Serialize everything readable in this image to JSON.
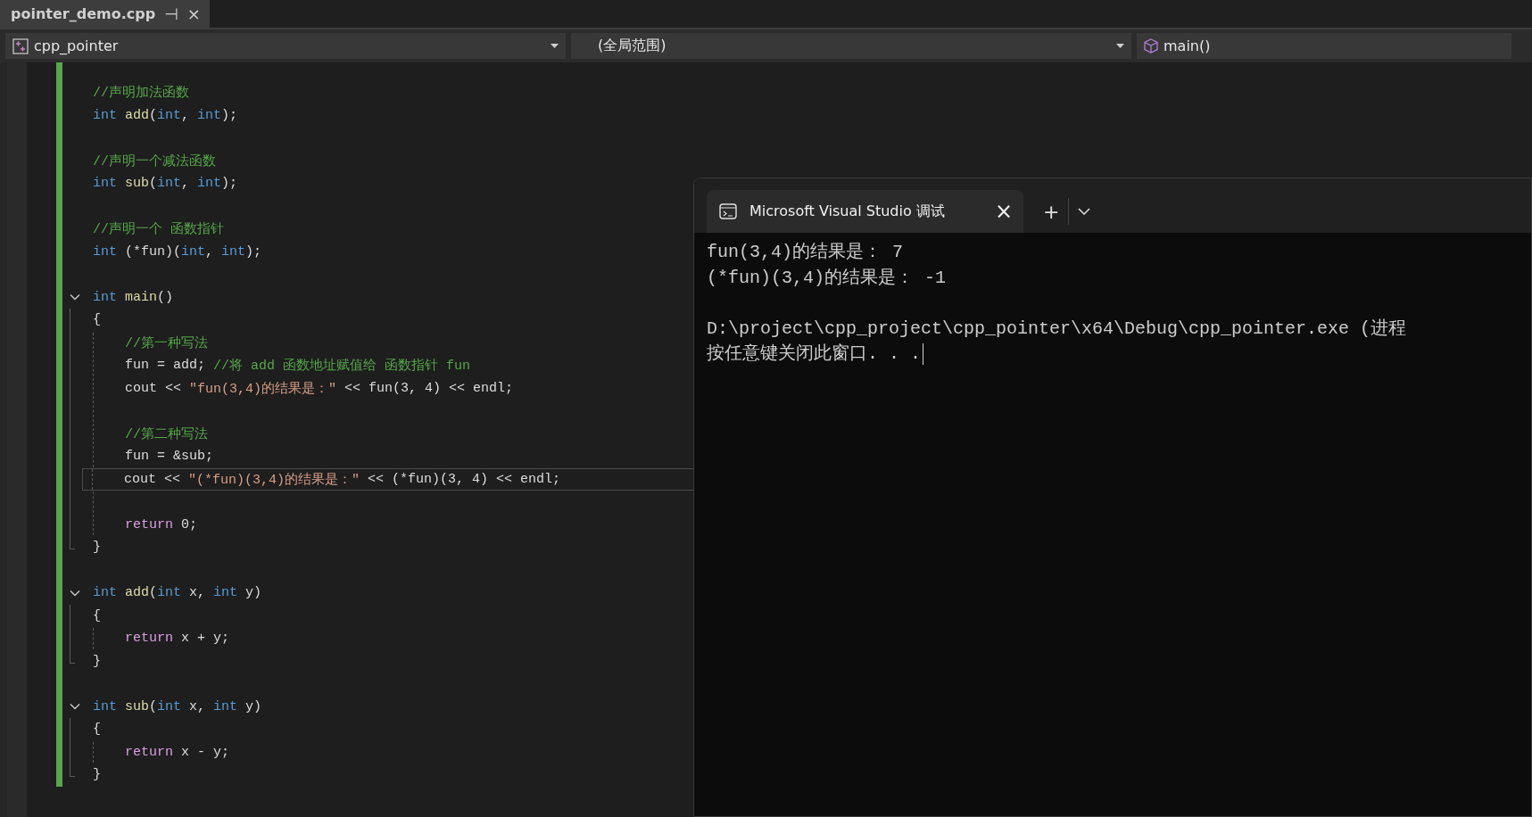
{
  "document_tab": {
    "title": "pointer_demo.cpp",
    "pin": "⊣",
    "close": "×",
    "selected": true
  },
  "navigation_bar": {
    "project": "cpp_pointer",
    "scope": "(全局范围)",
    "member": "main()"
  },
  "editor": {
    "modified": true,
    "lines": [
      {
        "kind": "plain",
        "tokens": [
          {
            "text": "//声明加法函数",
            "kind": "comment"
          }
        ]
      },
      {
        "kind": "plain",
        "tokens": [
          {
            "text": "int",
            "kind": "keyword"
          },
          {
            "text": " add",
            "kind": "function"
          },
          {
            "text": "(",
            "kind": "plain"
          },
          {
            "text": "int",
            "kind": "keyword"
          },
          {
            "text": ", ",
            "kind": "plain"
          },
          {
            "text": "int",
            "kind": "keyword"
          },
          {
            "text": ");",
            "kind": "plain"
          }
        ]
      },
      {
        "kind": "plain"
      },
      {
        "kind": "plain",
        "tokens": [
          {
            "text": "//声明一个减法函数",
            "kind": "comment"
          }
        ]
      },
      {
        "kind": "plain",
        "tokens": [
          {
            "text": "int",
            "kind": "keyword"
          },
          {
            "text": " sub",
            "kind": "function"
          },
          {
            "text": "(",
            "kind": "plain"
          },
          {
            "text": "int",
            "kind": "keyword"
          },
          {
            "text": ", ",
            "kind": "plain"
          },
          {
            "text": "int",
            "kind": "keyword"
          },
          {
            "text": ");",
            "kind": "plain"
          }
        ]
      },
      {
        "kind": "plain"
      },
      {
        "kind": "plain",
        "tokens": [
          {
            "text": "//声明一个 函数指针",
            "kind": "comment"
          }
        ]
      },
      {
        "kind": "plain",
        "tokens": [
          {
            "text": "int",
            "kind": "keyword"
          },
          {
            "text": " (*fun)(",
            "kind": "plain"
          },
          {
            "text": "int",
            "kind": "keyword"
          },
          {
            "text": ", ",
            "kind": "plain"
          },
          {
            "text": "int",
            "kind": "keyword"
          },
          {
            "text": ");",
            "kind": "plain"
          }
        ]
      },
      {
        "kind": "plain"
      },
      {
        "kind": "fold-start",
        "expanded": true,
        "tokens": [
          {
            "text": "int",
            "kind": "keyword"
          },
          {
            "text": " main",
            "kind": "function"
          },
          {
            "text": "()",
            "kind": "plain"
          }
        ]
      },
      {
        "kind": "fold-body",
        "tokens": [
          {
            "text": "{",
            "kind": "plain"
          }
        ]
      },
      {
        "kind": "fold-body",
        "indented": true,
        "tokens": [
          {
            "text": "//第一种写法",
            "kind": "comment"
          }
        ]
      },
      {
        "kind": "fold-body",
        "indented": true,
        "tokens": [
          {
            "text": "fun = add; ",
            "kind": "plain"
          },
          {
            "text": "//将 add 函数地址赋值给 函数指针 fun",
            "kind": "comment"
          }
        ]
      },
      {
        "kind": "fold-body",
        "indented": true,
        "tokens": [
          {
            "text": "cout << ",
            "kind": "plain"
          },
          {
            "text": "\"fun(3,4)的结果是：\"",
            "kind": "string"
          },
          {
            "text": " << fun(3, 4) << endl;",
            "kind": "plain"
          }
        ]
      },
      {
        "kind": "fold-body",
        "indented": true
      },
      {
        "kind": "fold-body",
        "indented": true,
        "tokens": [
          {
            "text": "//第二种写法",
            "kind": "comment"
          }
        ]
      },
      {
        "kind": "fold-body",
        "indented": true,
        "tokens": [
          {
            "text": "fun = &sub;",
            "kind": "plain"
          }
        ]
      },
      {
        "kind": "fold-body",
        "indented": true,
        "current": true,
        "tokens": [
          {
            "text": "cout << ",
            "kind": "plain"
          },
          {
            "text": "\"(*fun)(3,4)的结果是：\"",
            "kind": "string"
          },
          {
            "text": " << (*fun)(3, 4) << endl;",
            "kind": "plain"
          }
        ]
      },
      {
        "kind": "fold-body",
        "indented": true
      },
      {
        "kind": "fold-body",
        "indented": true,
        "tokens": [
          {
            "text": "return",
            "kind": "control"
          },
          {
            "text": " 0;",
            "kind": "plain"
          }
        ]
      },
      {
        "kind": "fold-end",
        "tokens": [
          {
            "text": "}",
            "kind": "plain"
          }
        ]
      },
      {
        "kind": "plain"
      },
      {
        "kind": "fold-start",
        "expanded": true,
        "tokens": [
          {
            "text": "int",
            "kind": "keyword"
          },
          {
            "text": " add",
            "kind": "function"
          },
          {
            "text": "(",
            "kind": "plain"
          },
          {
            "text": "int",
            "kind": "keyword"
          },
          {
            "text": " x, ",
            "kind": "plain"
          },
          {
            "text": "int",
            "kind": "keyword"
          },
          {
            "text": " y)",
            "kind": "plain"
          }
        ]
      },
      {
        "kind": "fold-body",
        "tokens": [
          {
            "text": "{",
            "kind": "plain"
          }
        ]
      },
      {
        "kind": "fold-body",
        "indented": true,
        "tokens": [
          {
            "text": "return",
            "kind": "control"
          },
          {
            "text": " x + y;",
            "kind": "plain"
          }
        ]
      },
      {
        "kind": "fold-end",
        "tokens": [
          {
            "text": "}",
            "kind": "plain"
          }
        ]
      },
      {
        "kind": "plain"
      },
      {
        "kind": "fold-start",
        "expanded": true,
        "tokens": [
          {
            "text": "int",
            "kind": "keyword"
          },
          {
            "text": " sub",
            "kind": "function"
          },
          {
            "text": "(",
            "kind": "plain"
          },
          {
            "text": "int",
            "kind": "keyword"
          },
          {
            "text": " x, ",
            "kind": "plain"
          },
          {
            "text": "int",
            "kind": "keyword"
          },
          {
            "text": " y)",
            "kind": "plain"
          }
        ]
      },
      {
        "kind": "fold-body",
        "tokens": [
          {
            "text": "{",
            "kind": "plain"
          }
        ]
      },
      {
        "kind": "fold-body",
        "indented": true,
        "tokens": [
          {
            "text": "return",
            "kind": "control"
          },
          {
            "text": " x - y;",
            "kind": "plain"
          }
        ]
      },
      {
        "kind": "fold-end",
        "tokens": [
          {
            "text": "}",
            "kind": "plain"
          }
        ]
      }
    ]
  },
  "console_window": {
    "tab_title": "Microsoft Visual Studio 调试",
    "close": "×",
    "new_tab": "+",
    "program_output": [
      {
        "text": "fun(3,4)的结果是： 7"
      },
      {
        "text": "(*fun)(3,4)的结果是： -1"
      }
    ],
    "exit_message": [
      {
        "text": "D:\\project\\cpp_project\\cpp_pointer\\x64\\Debug\\cpp_pointer.exe (进程"
      },
      {
        "text": "按任意键关闭此窗口. . .",
        "cursor": true
      }
    ]
  }
}
